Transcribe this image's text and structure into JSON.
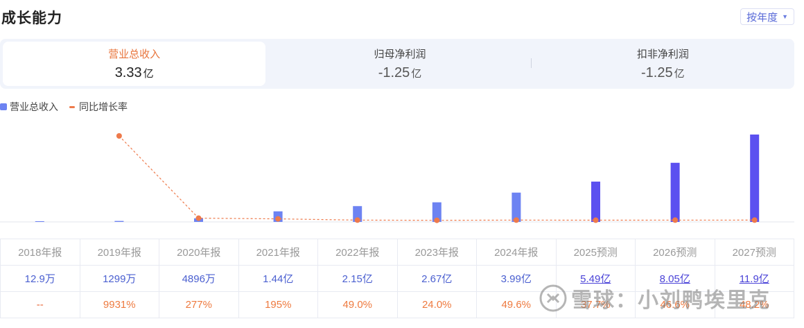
{
  "header": {
    "title": "成长能力",
    "period_button": "按年度"
  },
  "tabs": [
    {
      "label": "营业总收入",
      "value": "3.33",
      "unit": "亿",
      "active": true
    },
    {
      "label": "归母净利润",
      "value": "-1.25",
      "unit": "亿",
      "active": false
    },
    {
      "label": "扣非净利润",
      "value": "-1.25",
      "unit": "亿",
      "active": false
    }
  ],
  "legend": {
    "bar_label": "营业总收入",
    "line_label": "同比增长率"
  },
  "colors": {
    "actual_bar": "#6d83f2",
    "forecast_bar": "#5b50f0",
    "growth_line": "#ee7a4b"
  },
  "chart_data": {
    "type": "bar",
    "categories": [
      "2018年报",
      "2019年报",
      "2020年报",
      "2021年报",
      "2022年报",
      "2023年报",
      "2024年报",
      "2025预测",
      "2026预测",
      "2027预测"
    ],
    "series": [
      {
        "name": "营业总收入",
        "type": "bar",
        "unit": "亿",
        "values": [
          0.00129,
          0.1299,
          0.4896,
          1.44,
          2.15,
          2.67,
          3.99,
          5.49,
          8.05,
          11.9
        ],
        "forecast_from_index": 7
      },
      {
        "name": "同比增长率",
        "type": "line",
        "unit": "%",
        "values": [
          null,
          9931,
          277,
          195,
          49.0,
          24.0,
          49.6,
          37.7,
          46.6,
          48.2
        ]
      }
    ]
  },
  "table": {
    "years": [
      "2018年报",
      "2019年报",
      "2020年报",
      "2021年报",
      "2022年报",
      "2023年报",
      "2024年报",
      "2025预测",
      "2026预测",
      "2027预测"
    ],
    "revenue": [
      "12.9万",
      "1299万",
      "4896万",
      "1.44亿",
      "2.15亿",
      "2.67亿",
      "3.99亿",
      "5.49亿",
      "8.05亿",
      "11.9亿"
    ],
    "growth": [
      "--",
      "9931%",
      "277%",
      "195%",
      "49.0%",
      "24.0%",
      "49.6%",
      "37.7%",
      "46.6%",
      "48.2%"
    ]
  },
  "watermark": {
    "text": "雪球：小刘鸭埃里克"
  }
}
